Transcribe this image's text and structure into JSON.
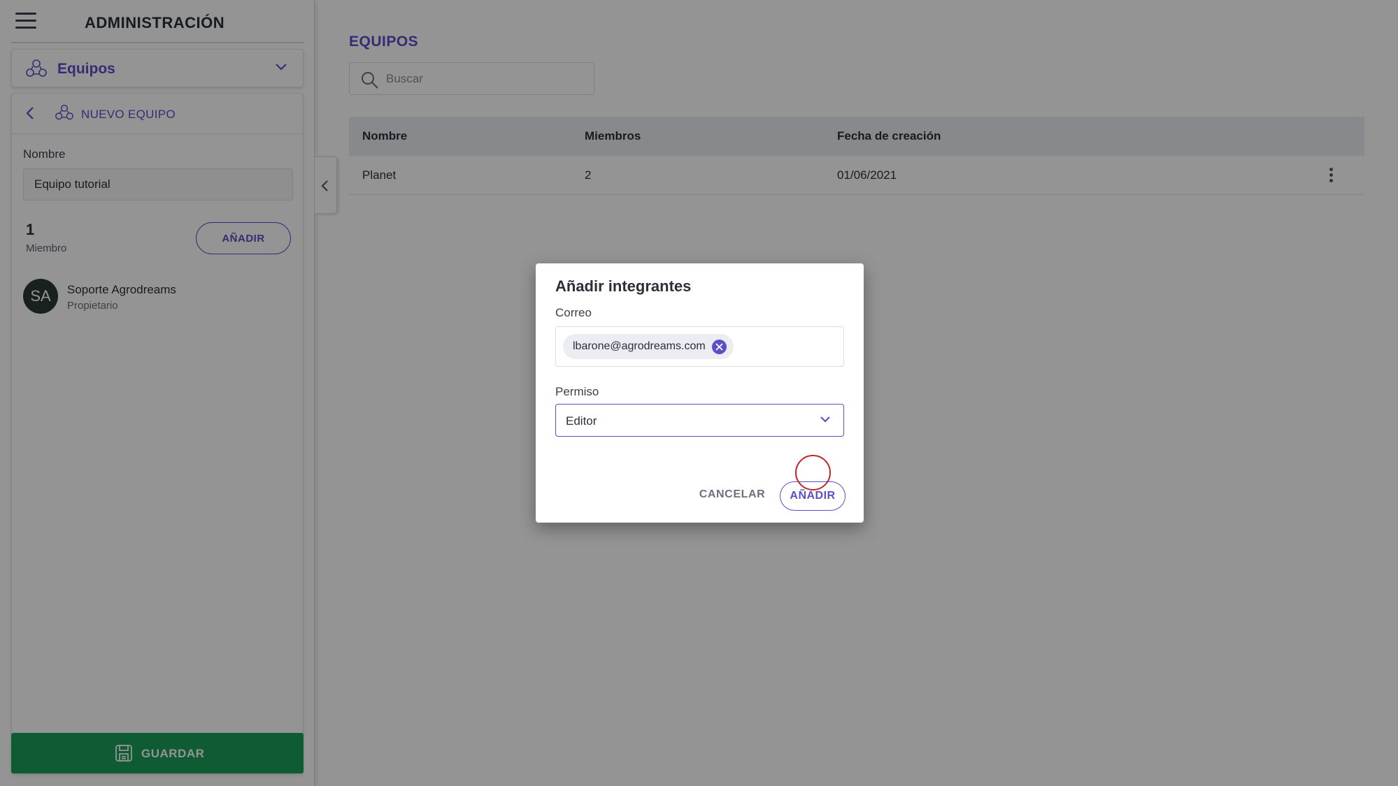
{
  "sidebar": {
    "title": "ADMINISTRACIÓN",
    "section": "Equipos",
    "panel_title": "NUEVO EQUIPO",
    "name_label": "Nombre",
    "name_value": "Equipo tutorial",
    "member_count": "1",
    "member_label": "Miembro",
    "add_button": "AÑADIR",
    "members": [
      {
        "initials": "SA",
        "name": "Soporte Agrodreams",
        "role": "Propietario"
      }
    ],
    "save_button": "GUARDAR"
  },
  "main": {
    "title": "EQUIPOS",
    "search_placeholder": "Buscar",
    "columns": [
      "Nombre",
      "Miembros",
      "Fecha de creación"
    ],
    "rows": [
      {
        "name": "Planet",
        "members": "2",
        "created": "01/06/2021"
      }
    ]
  },
  "dialog": {
    "title": "Añadir integrantes",
    "email_label": "Correo",
    "email_chip": "lbarone@agrodreams.com",
    "permission_label": "Permiso",
    "permission_value": "Editor",
    "cancel_button": "CANCELAR",
    "add_button": "AÑADIR"
  },
  "colors": {
    "accent": "#5b4fc9",
    "save": "#1a9e5a",
    "avatar": "#2c3a36",
    "click_marker": "#c0262b"
  },
  "icons": [
    "menu-icon",
    "team-icon",
    "chevron-down-icon",
    "chevron-left-icon",
    "save-icon",
    "search-icon",
    "more-vert-icon",
    "close-icon"
  ]
}
